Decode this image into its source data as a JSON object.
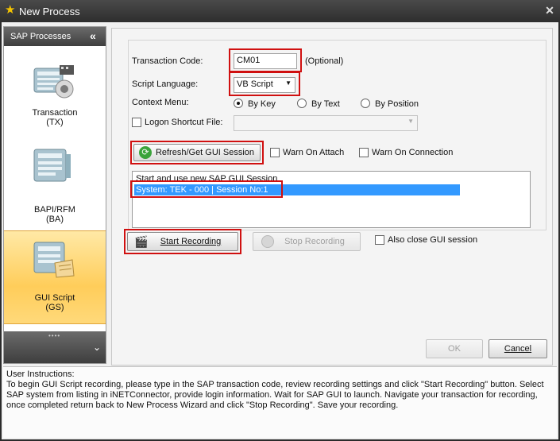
{
  "window": {
    "title": "New Process"
  },
  "sidebar": {
    "header": "SAP Processes",
    "items": [
      {
        "label": "Transaction",
        "sub": "(TX)"
      },
      {
        "label": "BAPI/RFM",
        "sub": "(BA)"
      },
      {
        "label": "GUI Script",
        "sub": "(GS)"
      }
    ]
  },
  "form": {
    "transaction_code_label": "Transaction Code:",
    "transaction_code_value": "CM01",
    "optional_note": "(Optional)",
    "script_language_label": "Script Language:",
    "script_language_value": "VB Script",
    "context_menu_label": "Context Menu:",
    "radio_by_key": "By Key",
    "radio_by_text": "By Text",
    "radio_by_position": "By Position",
    "logon_shortcut_label": "Logon Shortcut File:",
    "logon_shortcut_value": "",
    "refresh_button": "Refresh/Get GUI Session",
    "warn_on_attach": "Warn On Attach",
    "warn_on_connection": "Warn On Connection",
    "sessions": [
      "Start and use new SAP GUI Session",
      "System: TEK - 000 | Session No:1"
    ]
  },
  "recording": {
    "start_button": "Start Recording",
    "stop_button": "Stop Recording",
    "also_close": "Also close GUI session"
  },
  "dialog_buttons": {
    "ok": "OK",
    "cancel": "Cancel"
  },
  "instructions": {
    "heading": "User Instructions:",
    "text": "To begin GUI Script recording, please type in the SAP transaction code, review recording settings and click \"Start Recording\" button. Select SAP system from listing in iNETConnector, provide login information. Wait for SAP GUI to launch. Navigate your transaction for recording, once completed return back to New Process Wizard and click \"Stop Recording\". Save your recording."
  },
  "colors": {
    "highlight_red": "#d01010",
    "selection_blue": "#3399ff",
    "selected_nav": "#ffcd5a"
  }
}
